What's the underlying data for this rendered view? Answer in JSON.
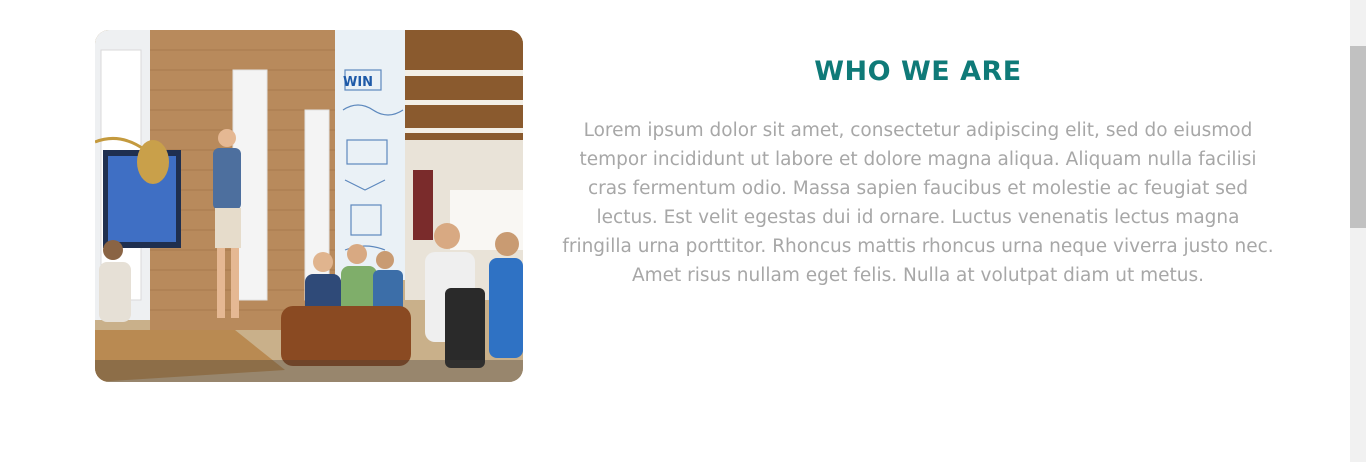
{
  "about": {
    "heading": "WHO WE ARE",
    "body": "Lorem ipsum dolor sit amet, consectetur adipiscing elit, sed do eiusmod tempor incididunt ut labore et dolore magna aliqua. Aliquam nulla facilisi cras fermentum odio. Massa sapien faucibus et molestie ac feugiat sed lectus. Est velit egestas dui id ornare. Luctus venenatis lectus magna fringilla urna porttitor. Rhoncus mattis rhoncus urna neque viverra justo nec. Amet risus nullam eget felis. Nulla at volutpat diam ut metus.",
    "photo_sign_text": "WIN"
  },
  "colors": {
    "heading": "#0f7a78",
    "body_text": "#a7a7a7",
    "background": "#ffffff"
  }
}
